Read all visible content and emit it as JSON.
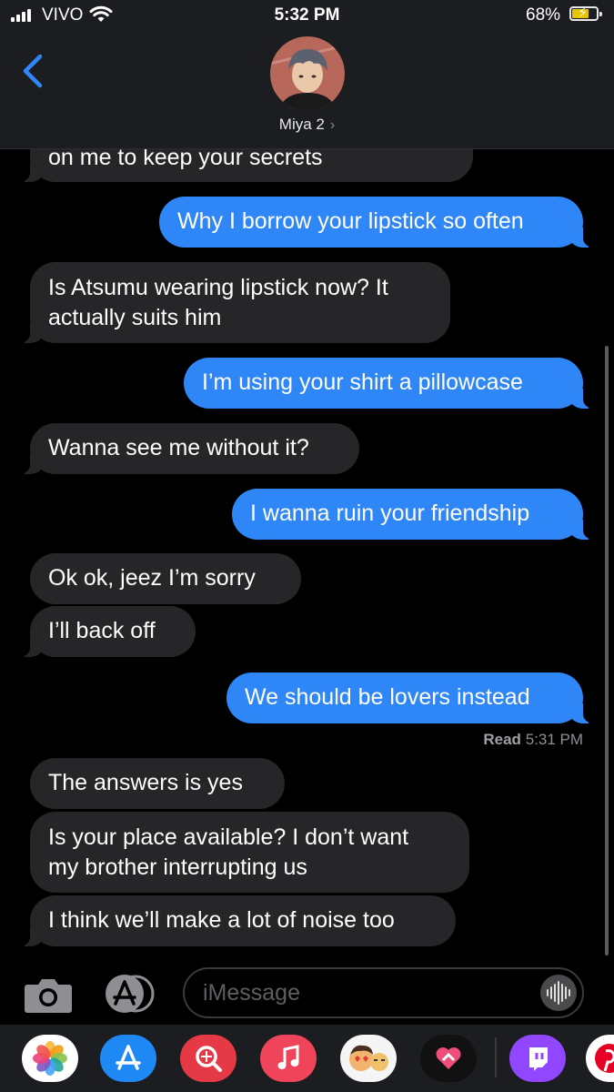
{
  "status_bar": {
    "carrier": "VIVO",
    "time": "5:32 PM",
    "battery": "68%",
    "battery_level": 0.68
  },
  "header": {
    "contact_name": "Miya 2",
    "chevron": "›"
  },
  "messages": [
    {
      "side": "in",
      "text": "on me to keep your secrets"
    },
    {
      "side": "out",
      "text": "Why I borrow your lipstick so often"
    },
    {
      "side": "in",
      "lines": [
        "Is Atsumu wearing lipstick now? It",
        "actually suits him"
      ]
    },
    {
      "side": "out",
      "text": "I’m using your shirt a pillowcase"
    },
    {
      "side": "in",
      "text": "Wanna see me without it?"
    },
    {
      "side": "out",
      "text": "I wanna ruin your friendship"
    },
    {
      "side": "in",
      "text": "Ok ok, jeez I’m sorry"
    },
    {
      "side": "in",
      "text": "I’ll back off"
    },
    {
      "side": "out",
      "text": "We should be lovers instead"
    },
    {
      "side": "in",
      "text": "The answers is yes"
    },
    {
      "side": "in",
      "lines": [
        "Is your place available? I don’t want",
        "my brother interrupting us"
      ]
    },
    {
      "side": "in",
      "text": "I think we’ll make a lot of noise too"
    }
  ],
  "receipt": {
    "label": "Read",
    "time": "5:31 PM"
  },
  "input": {
    "placeholder": "iMessage"
  },
  "app_drawer": [
    "photos-icon",
    "app-store-icon",
    "image-search-icon",
    "music-icon",
    "memoji-icon",
    "heart-app-icon",
    "twitch-icon",
    "pinterest-icon"
  ],
  "colors": {
    "outgoing": "#2f86f6",
    "incoming": "#262629",
    "header": "#1c1d20"
  }
}
